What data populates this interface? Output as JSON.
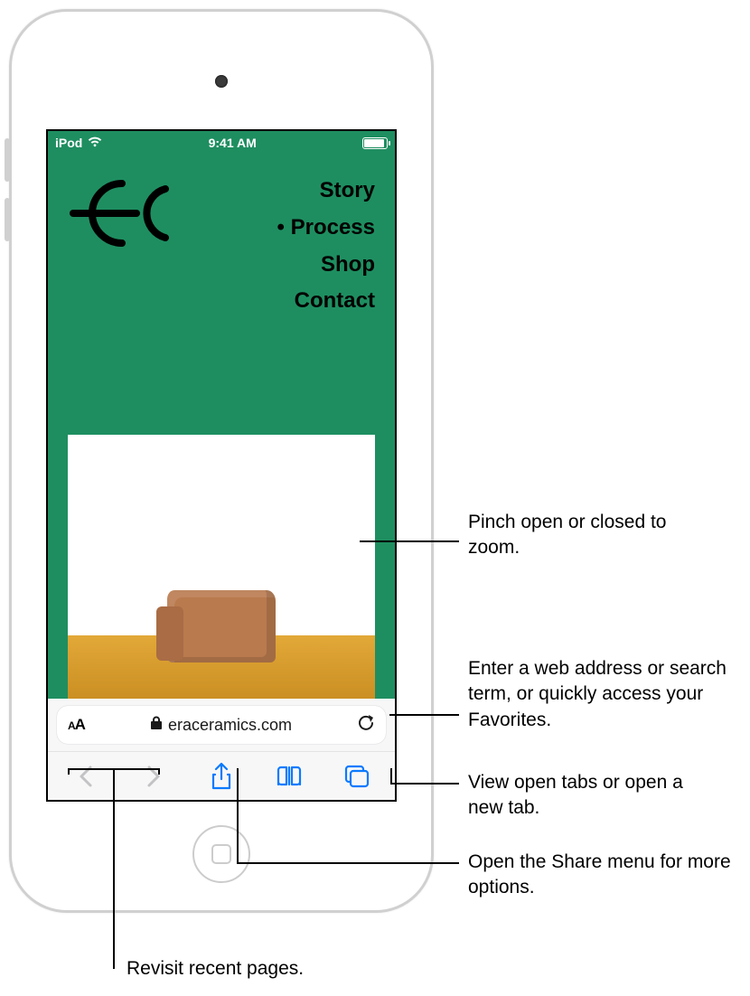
{
  "status_bar": {
    "device_label": "iPod",
    "time": "9:41 AM"
  },
  "site": {
    "menu": {
      "story": "Story",
      "process": "Process",
      "shop": "Shop",
      "contact": "Contact"
    }
  },
  "address_bar": {
    "domain": "eraceramics.com"
  },
  "callouts": {
    "zoom": "Pinch open or closed to zoom.",
    "address": "Enter a web address or search term, or quickly access your Favorites.",
    "tabs": "View open tabs or open a new tab.",
    "share": "Open the Share menu for more options.",
    "recent": "Revisit recent pages."
  }
}
